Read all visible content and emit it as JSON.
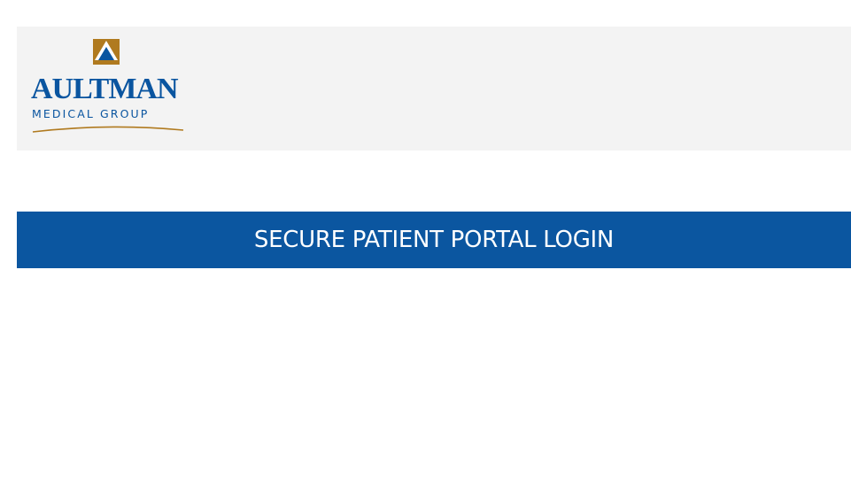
{
  "header": {
    "logo": {
      "name": "AULTMAN",
      "subtitle": "MEDICAL GROUP",
      "mark_icon": "aultman-triangle-logo-icon",
      "colors": {
        "brand_blue": "#0a55a0",
        "gold": "#b07a1f"
      }
    },
    "background": "#f3f3f3"
  },
  "banner": {
    "title": "SECURE PATIENT PORTAL LOGIN",
    "background": "#0b56a0",
    "text_color": "#ffffff"
  }
}
